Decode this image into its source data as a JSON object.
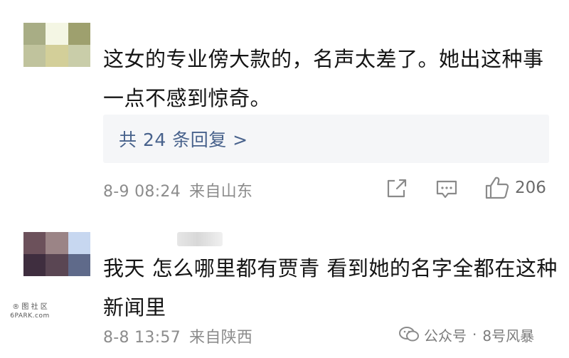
{
  "colors": {
    "avatar1": [
      "#a8ad85",
      "#f4f6e4",
      "#9ea06e",
      "#c0c39d",
      "#d3cf99",
      "#c9cda9"
    ],
    "avatar2": [
      "#6c515b",
      "#9b8486",
      "#c7d7f0",
      "#3f2e3f",
      "#5a4653",
      "#5f6a8a"
    ],
    "reply_link": "#48628c",
    "meta_text": "#8c8c8c"
  },
  "comments": [
    {
      "content": "这女的专业傍大款的，名声太差了。她出这种事一点不感到惊奇。",
      "reply_label": "共 24 条回复 >",
      "date": "8-9 08:24",
      "location": "来自山东",
      "actions": {
        "share_icon": "share-icon",
        "comment_icon": "comment-icon",
        "like_icon": "thumbs-up-icon",
        "like_count": "206"
      }
    },
    {
      "content": "我天 怎么哪里都有贾青 看到她的名字全都在这种新闻里",
      "date": "8-8 13:57",
      "location": "来自陕西"
    }
  ],
  "watermarks": {
    "left_line1": "® 图 社 区",
    "left_line2": "6PARK.com",
    "right_label": "公众号",
    "right_name": "8号风暴"
  }
}
